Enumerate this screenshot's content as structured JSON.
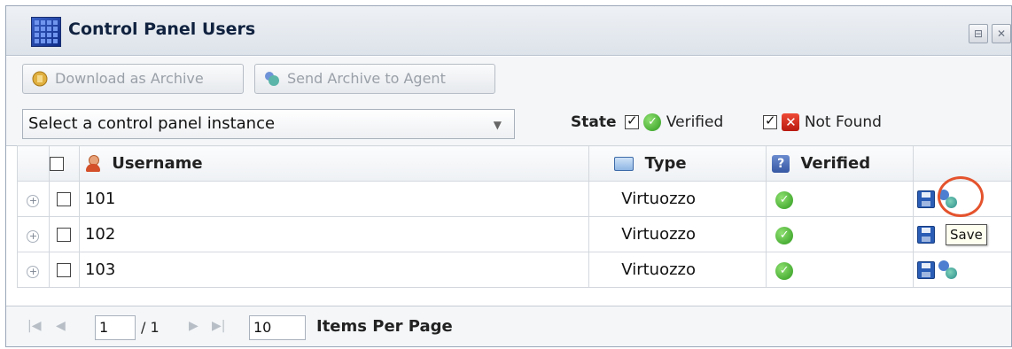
{
  "window": {
    "title": "Control Panel Users",
    "controls": [
      "⊟",
      "✕"
    ]
  },
  "toolbar": {
    "download_label": "Download as Archive",
    "send_label": "Send Archive to Agent"
  },
  "filter": {
    "select_value": "Select a control panel instance",
    "state_label": "State",
    "verified_label": "Verified",
    "not_found_label": "Not Found",
    "verified_checked": true,
    "not_found_checked": true
  },
  "grid": {
    "headers": {
      "username": "Username",
      "type": "Type",
      "verified": "Verified"
    },
    "rows": [
      {
        "username": "101",
        "type": "Virtuozzo",
        "verified": true
      },
      {
        "username": "102",
        "type": "Virtuozzo",
        "verified": true
      },
      {
        "username": "103",
        "type": "Virtuozzo",
        "verified": true
      }
    ]
  },
  "tooltip": "Save",
  "pager": {
    "page": "1",
    "page_total": "/ 1",
    "items_per_page_value": "10",
    "items_per_page_label": "Items Per Page"
  },
  "icons": {
    "app": "grid-app-icon",
    "download": "archive-icon",
    "send": "send-agent-icon",
    "user": "user-icon",
    "type": "type-icon",
    "verified_header": "question-icon",
    "status_ok": "check-circle-icon",
    "status_nf": "cross-box-icon",
    "save": "save-icon",
    "agent": "agent-icon"
  },
  "colors": {
    "accent_ring": "#e4532d",
    "ok_green": "#2f9a1e",
    "error_red": "#b81a10",
    "save_blue": "#2a5db5"
  }
}
